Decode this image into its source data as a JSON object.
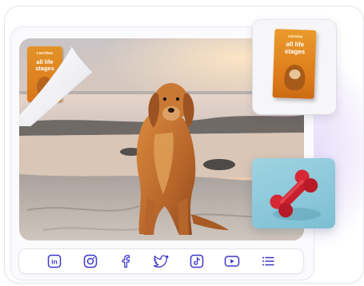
{
  "product": {
    "brand": "canidae",
    "title": "all life stages"
  },
  "social_links": [
    {
      "name": "linkedin-icon",
      "label": "in"
    },
    {
      "name": "instagram-icon"
    },
    {
      "name": "facebook-icon",
      "label": "f"
    },
    {
      "name": "twitter-icon"
    },
    {
      "name": "tiktok-icon"
    },
    {
      "name": "youtube-icon"
    },
    {
      "name": "menu-icon"
    }
  ],
  "colors": {
    "icon": "#3f37c9",
    "accent_glow": "#e7defa",
    "bag_orange": "#dd7b1a",
    "bone_red": "#c81f2c",
    "bone_card_bg": "#8ccadb"
  }
}
